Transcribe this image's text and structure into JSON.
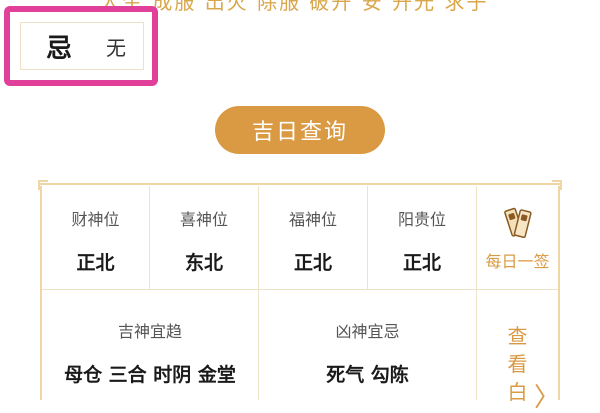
{
  "top_strip_text": "人生 成服 出火 除服 破开 安 开光 求子",
  "ji": {
    "label": "忌",
    "value": "无"
  },
  "query_button": {
    "label": "吉日查询"
  },
  "directions": [
    {
      "label": "财神位",
      "value": "正北"
    },
    {
      "label": "喜神位",
      "value": "东北"
    },
    {
      "label": "福神位",
      "value": "正北"
    },
    {
      "label": "阳贵位",
      "value": "正北"
    }
  ],
  "daily_sign": {
    "label": "每日一签",
    "icon": "lottery-sign-icon"
  },
  "lucky_gods": {
    "label": "吉神宜趋",
    "value": "母仓 三合 时阴 金堂"
  },
  "evil_gods": {
    "label": "凶神宜忌",
    "value": "死气 勾陈"
  },
  "side_link": {
    "chars": [
      "查",
      "看",
      "白"
    ],
    "icon": "chevron-right-icon"
  },
  "colors": {
    "accent": "#d99a43",
    "highlight": "#e0409a",
    "border": "#efd6a6"
  }
}
